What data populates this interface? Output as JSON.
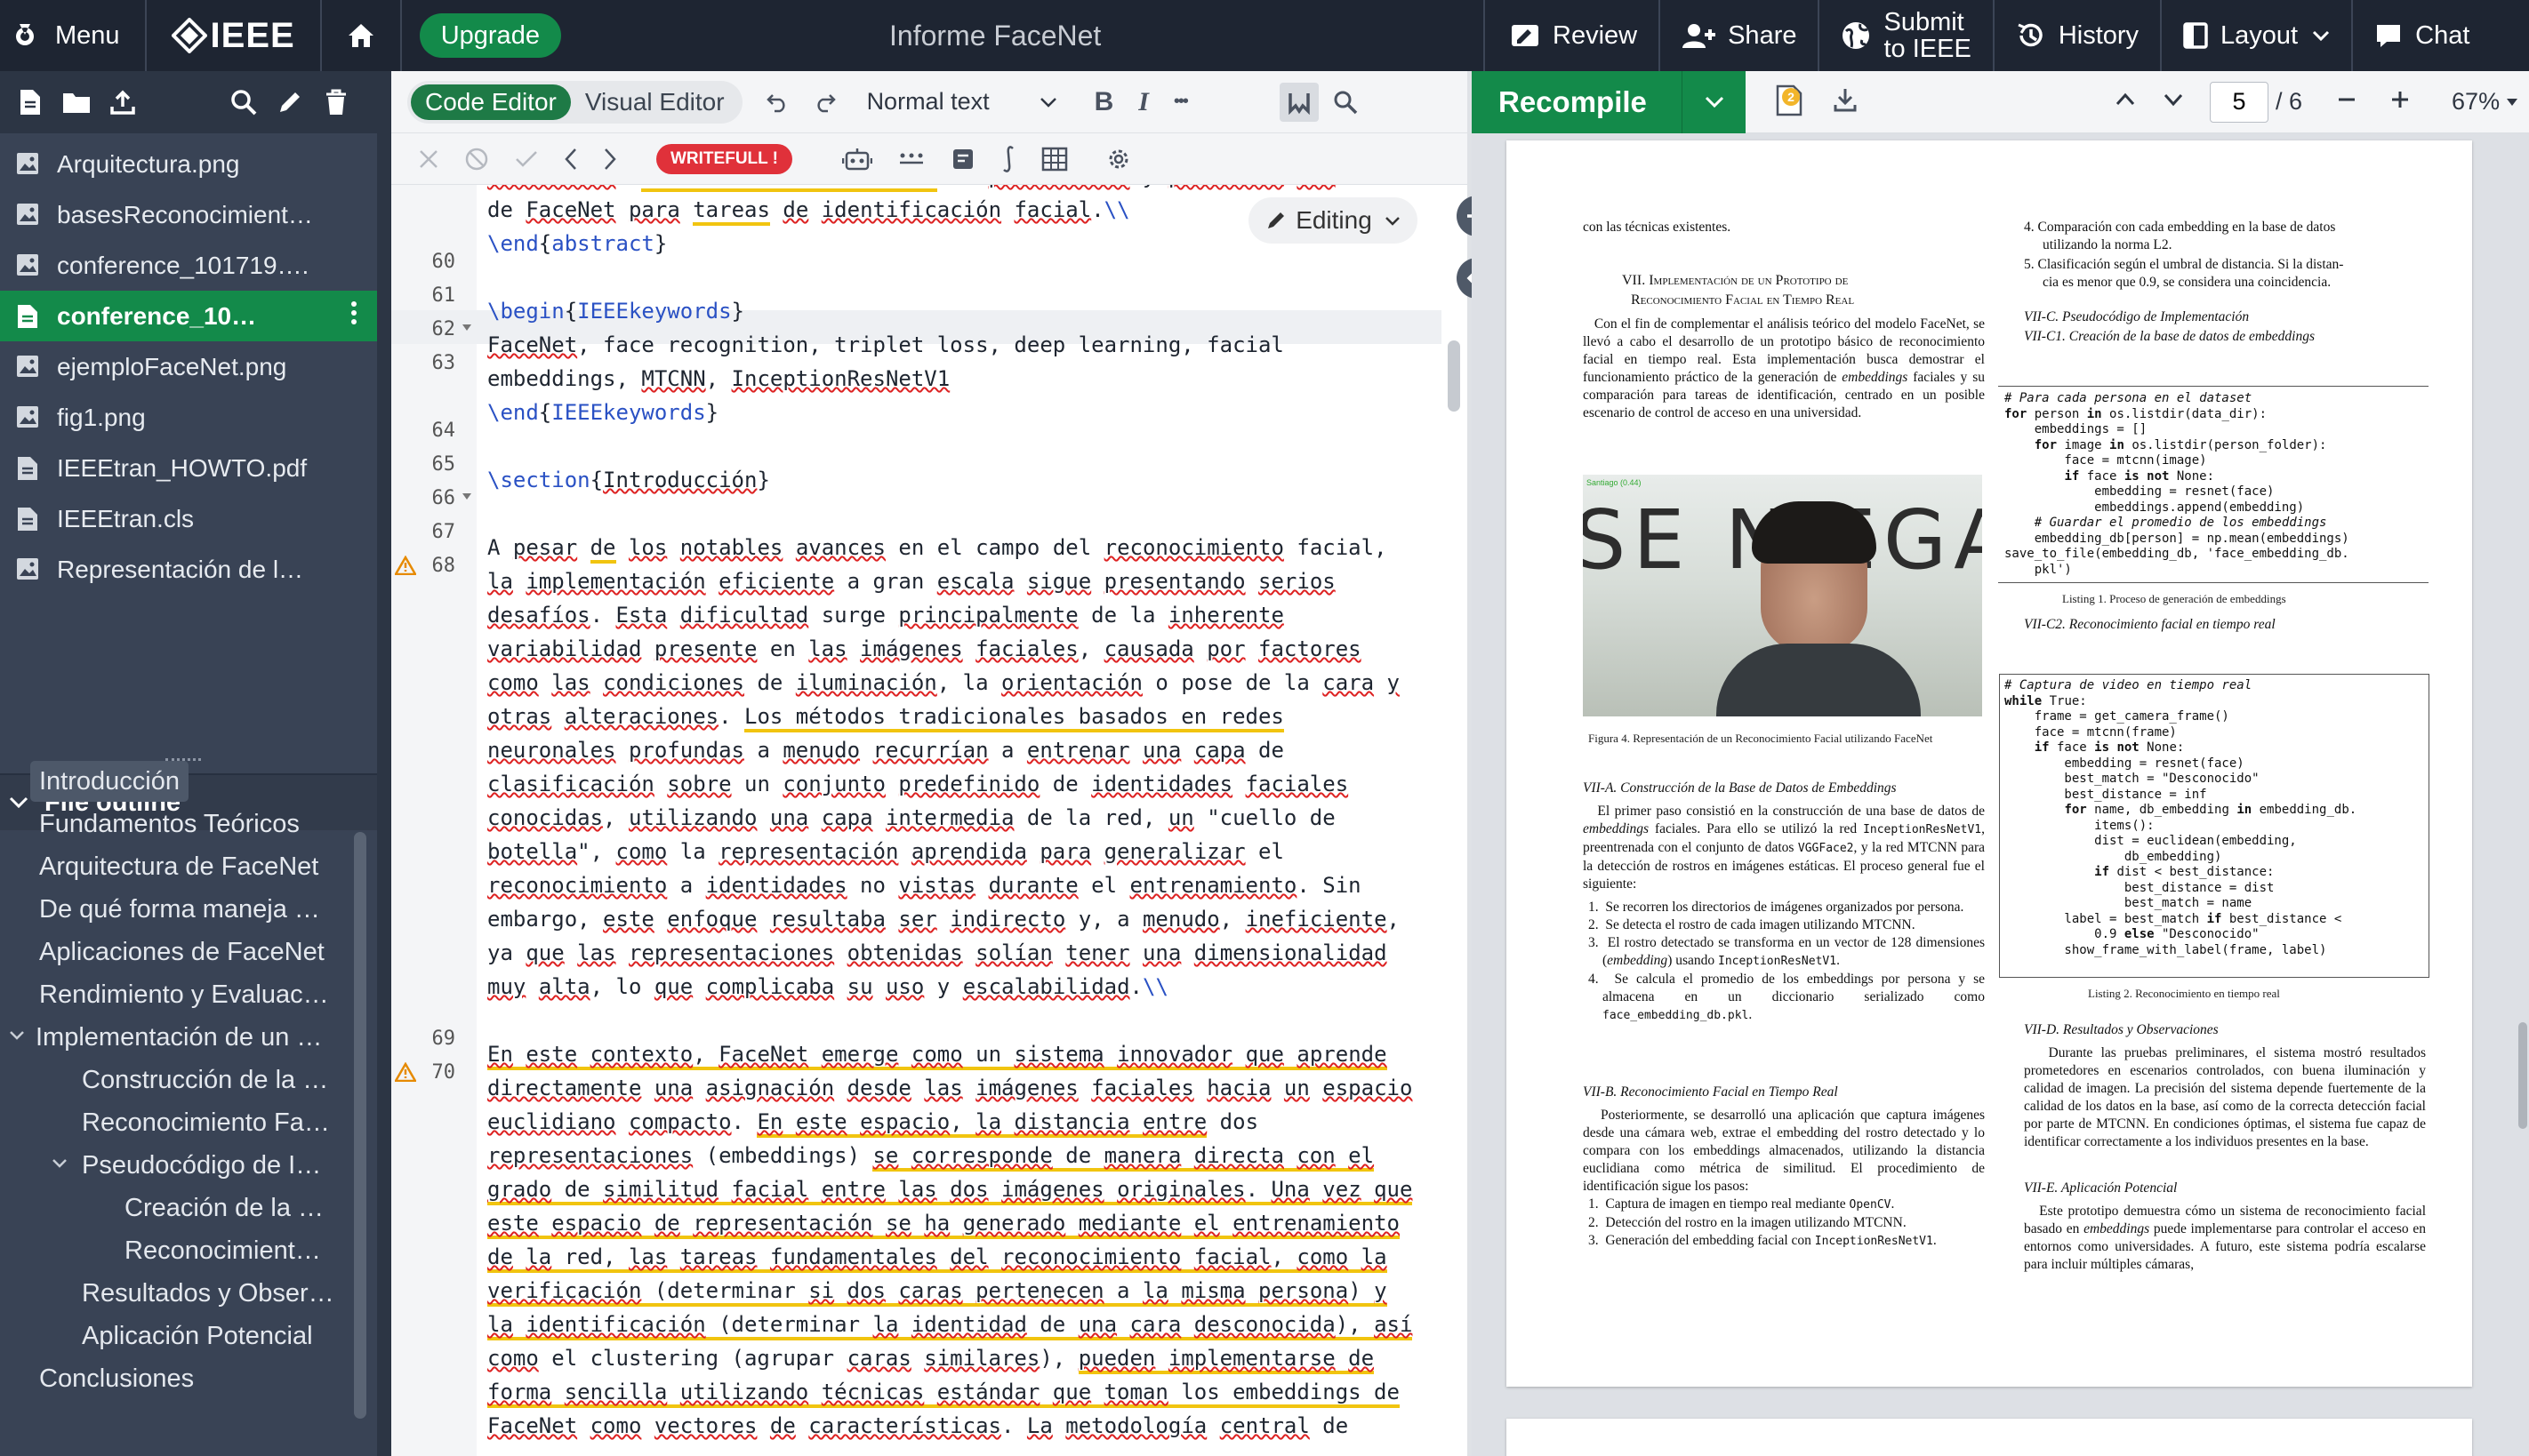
{
  "topbar": {
    "menu": "Menu",
    "brand": "IEEE",
    "upgrade": "Upgrade",
    "project_title": "Informe FaceNet",
    "review": "Review",
    "share": "Share",
    "submit_line1": "Submit",
    "submit_line2": "to IEEE",
    "history": "History",
    "layout": "Layout",
    "chat": "Chat"
  },
  "files": [
    {
      "name": "Arquitectura.png",
      "type": "image"
    },
    {
      "name": "basesReconocimient…",
      "type": "image"
    },
    {
      "name": "conference_101719….",
      "type": "image"
    },
    {
      "name": "conference_10…",
      "type": "tex",
      "active": true
    },
    {
      "name": "ejemploFaceNet.png",
      "type": "image"
    },
    {
      "name": "fig1.png",
      "type": "image"
    },
    {
      "name": "IEEEtran_HOWTO.pdf",
      "type": "pdf"
    },
    {
      "name": "IEEEtran.cls",
      "type": "text"
    },
    {
      "name": "Representación de l…",
      "type": "image"
    }
  ],
  "outline": {
    "title": "File outline",
    "items": [
      "Introducción",
      "Fundamentos Teóricos",
      "Arquitectura de FaceNet",
      "De qué forma maneja …",
      "Aplicaciones de FaceNet",
      "Rendimiento y Evaluac…",
      "Implementación de un …",
      "Construcción de la …",
      "Reconocimiento Fa…",
      "Pseudocódigo de I…",
      "Creación de la …",
      "Reconocimient…",
      "Resultados y Obser…",
      "Aplicación Potencial",
      "Conclusiones"
    ]
  },
  "editor": {
    "code_editor": "Code Editor",
    "visual_editor": "Visual Editor",
    "style": "Normal text",
    "bold": "B",
    "italic": "I",
    "more": "•••",
    "writefull": "WRITEFULL !",
    "editing": "Editing",
    "line_numbers": [
      "60",
      "61",
      "62",
      "63",
      "",
      "64",
      "65",
      "66",
      "67",
      "68",
      "",
      "",
      "",
      "",
      "",
      "",
      "",
      "",
      "",
      "",
      "",
      "",
      "",
      "69",
      "70",
      "",
      "",
      "",
      "",
      "",
      "",
      "",
      "",
      "",
      ""
    ]
  },
  "pdf": {
    "recompile": "Recompile",
    "page": "5",
    "total": "/ 6",
    "zoom": "67%",
    "badge": "2"
  },
  "paper": {
    "c1_intro": "con las técnicas existentes.",
    "sec7_title_1": "VII.   Implementación de un Prototipo de",
    "sec7_title_2": "Reconocimiento Facial en Tiempo Real",
    "fig4": "Figura 4.   Representación de un Reconocimiento Facial utilizando FaceNet",
    "sub_a": "VII-A.   Construcción de la Base de Datos de Embeddings",
    "sub_b": "VII-B.   Reconocimiento Facial en Tiempo Real",
    "c2_top1": "4.  Comparación con cada embedding en la base de datos",
    "c2_top2": "utilizando la norma L2.",
    "c2_top3": "5.  Clasificación según el umbral de distancia. Si la distan-",
    "c2_top4": "cia es menor que 0.9, se considera una coincidencia.",
    "sub_c": "VII-C.   Pseudocódigo de Implementación",
    "sub_c1": "VII-C1.   Creación de la base de datos de embeddings",
    "listing1": "Listing 1.   Proceso de generación de embeddings",
    "sub_c2": "VII-C2.   Reconocimiento facial en tiempo real",
    "listing2": "Listing 2.   Reconocimiento en tiempo real",
    "sub_d": "VII-D.   Resultados y Observaciones",
    "sub_e": "VII-E.   Aplicación Potencial",
    "photo_text": "SE NIEGAS"
  }
}
